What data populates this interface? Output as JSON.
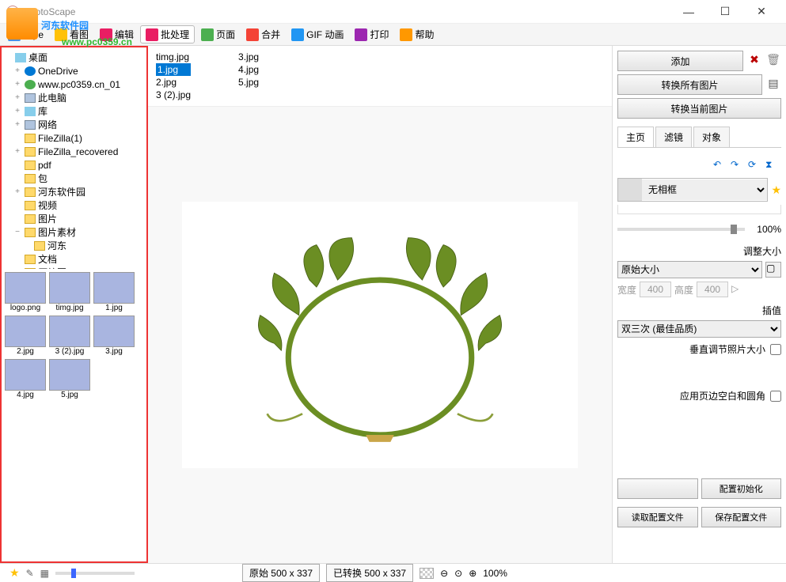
{
  "title": "PhotoScape",
  "watermark": {
    "text": "河东软件园",
    "url": "www.pc0359.cn"
  },
  "toolbar": {
    "items": [
      {
        "label": "cape",
        "color": "#4a90e2"
      },
      {
        "label": "看图",
        "color": "#ffc107"
      },
      {
        "label": "编辑",
        "color": "#e91e63"
      },
      {
        "label": "批处理",
        "color": "#e91e63",
        "active": true
      },
      {
        "label": "页面",
        "color": "#4caf50"
      },
      {
        "label": "合并",
        "color": "#f44336"
      },
      {
        "label": "GIF 动画",
        "color": "#2196f3"
      },
      {
        "label": "打印",
        "color": "#9c27b0"
      },
      {
        "label": "帮助",
        "color": "#ff9800"
      }
    ]
  },
  "tree": [
    {
      "exp": "",
      "icon": "lib",
      "label": "桌面",
      "ind": 0
    },
    {
      "exp": "+",
      "icon": "cloud",
      "label": "OneDrive",
      "ind": 1
    },
    {
      "exp": "+",
      "icon": "user",
      "label": "www.pc0359.cn_01",
      "ind": 1
    },
    {
      "exp": "+",
      "icon": "drive",
      "label": "此电脑",
      "ind": 1
    },
    {
      "exp": "+",
      "icon": "lib",
      "label": "库",
      "ind": 1
    },
    {
      "exp": "+",
      "icon": "drive",
      "label": "网络",
      "ind": 1
    },
    {
      "exp": "",
      "icon": "folder",
      "label": "FileZilla(1)",
      "ind": 1
    },
    {
      "exp": "+",
      "icon": "folder",
      "label": "FileZilla_recovered",
      "ind": 1
    },
    {
      "exp": "",
      "icon": "folder",
      "label": "pdf",
      "ind": 1
    },
    {
      "exp": "",
      "icon": "folder",
      "label": "包",
      "ind": 1
    },
    {
      "exp": "+",
      "icon": "folder",
      "label": "河东软件园",
      "ind": 1
    },
    {
      "exp": "",
      "icon": "folder",
      "label": "视频",
      "ind": 1
    },
    {
      "exp": "",
      "icon": "folder",
      "label": "图片",
      "ind": 1
    },
    {
      "exp": "−",
      "icon": "folder",
      "label": "图片素材",
      "ind": 1
    },
    {
      "exp": "",
      "icon": "folder",
      "label": "河东",
      "ind": 2
    },
    {
      "exp": "",
      "icon": "folder",
      "label": "文档",
      "ind": 1
    },
    {
      "exp": "",
      "icon": "folder",
      "label": "压缩图",
      "ind": 1
    }
  ],
  "thumbs": [
    [
      "logo.png",
      "timg.jpg",
      "1.jpg"
    ],
    [
      "2.jpg",
      "3 (2).jpg",
      "3.jpg"
    ],
    [
      "4.jpg",
      "5.jpg"
    ]
  ],
  "fileList": {
    "col1": [
      "timg.jpg",
      "1.jpg",
      "2.jpg",
      "3 (2).jpg"
    ],
    "col2": [
      "3.jpg",
      "4.jpg",
      "5.jpg"
    ],
    "selected": "1.jpg"
  },
  "right": {
    "add": "添加",
    "convAll": "转换所有图片",
    "convCur": "转换当前图片",
    "tabs": [
      "主页",
      "滤镜",
      "对象"
    ],
    "frame": "无相框",
    "sliderPct": "100%",
    "resize": "调整大小",
    "origSize": "原始大小",
    "widthLabel": "宽度",
    "widthVal": "400",
    "heightLabel": "高度",
    "heightVal": "400",
    "interp": "插值",
    "interpOpt": "双三次 (最佳品质)",
    "vertAdj": "垂直调节照片大小",
    "applyMargin": "应用页边空白和圆角",
    "cfgInit": "配置初始化",
    "readCfg": "读取配置文件",
    "saveCfg": "保存配置文件"
  },
  "status": {
    "orig": "原始 500 x 337",
    "conv": "已转换 500 x 337",
    "zoom": "100%"
  }
}
